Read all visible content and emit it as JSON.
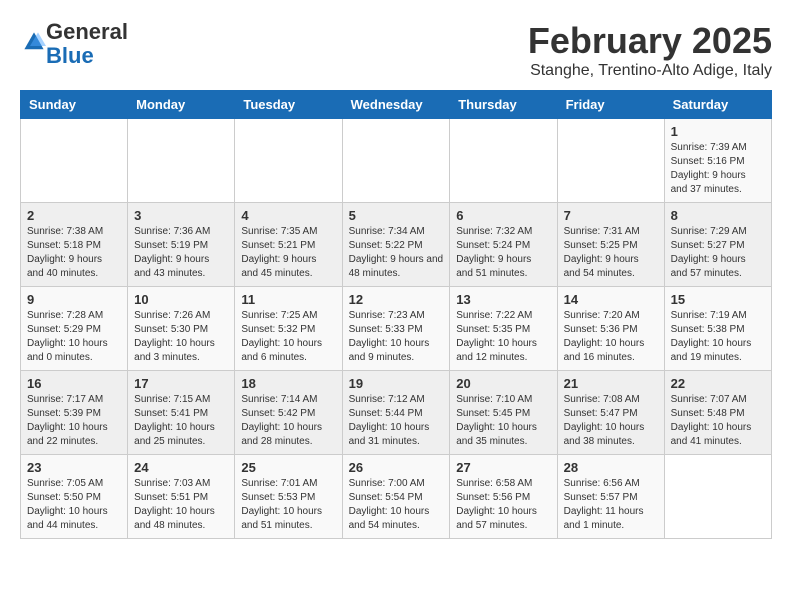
{
  "logo": {
    "general": "General",
    "blue": "Blue"
  },
  "header": {
    "month_title": "February 2025",
    "subtitle": "Stanghe, Trentino-Alto Adige, Italy"
  },
  "weekdays": [
    "Sunday",
    "Monday",
    "Tuesday",
    "Wednesday",
    "Thursday",
    "Friday",
    "Saturday"
  ],
  "weeks": [
    [
      {
        "day": "",
        "info": ""
      },
      {
        "day": "",
        "info": ""
      },
      {
        "day": "",
        "info": ""
      },
      {
        "day": "",
        "info": ""
      },
      {
        "day": "",
        "info": ""
      },
      {
        "day": "",
        "info": ""
      },
      {
        "day": "1",
        "info": "Sunrise: 7:39 AM\nSunset: 5:16 PM\nDaylight: 9 hours and 37 minutes."
      }
    ],
    [
      {
        "day": "2",
        "info": "Sunrise: 7:38 AM\nSunset: 5:18 PM\nDaylight: 9 hours and 40 minutes."
      },
      {
        "day": "3",
        "info": "Sunrise: 7:36 AM\nSunset: 5:19 PM\nDaylight: 9 hours and 43 minutes."
      },
      {
        "day": "4",
        "info": "Sunrise: 7:35 AM\nSunset: 5:21 PM\nDaylight: 9 hours and 45 minutes."
      },
      {
        "day": "5",
        "info": "Sunrise: 7:34 AM\nSunset: 5:22 PM\nDaylight: 9 hours and 48 minutes."
      },
      {
        "day": "6",
        "info": "Sunrise: 7:32 AM\nSunset: 5:24 PM\nDaylight: 9 hours and 51 minutes."
      },
      {
        "day": "7",
        "info": "Sunrise: 7:31 AM\nSunset: 5:25 PM\nDaylight: 9 hours and 54 minutes."
      },
      {
        "day": "8",
        "info": "Sunrise: 7:29 AM\nSunset: 5:27 PM\nDaylight: 9 hours and 57 minutes."
      }
    ],
    [
      {
        "day": "9",
        "info": "Sunrise: 7:28 AM\nSunset: 5:29 PM\nDaylight: 10 hours and 0 minutes."
      },
      {
        "day": "10",
        "info": "Sunrise: 7:26 AM\nSunset: 5:30 PM\nDaylight: 10 hours and 3 minutes."
      },
      {
        "day": "11",
        "info": "Sunrise: 7:25 AM\nSunset: 5:32 PM\nDaylight: 10 hours and 6 minutes."
      },
      {
        "day": "12",
        "info": "Sunrise: 7:23 AM\nSunset: 5:33 PM\nDaylight: 10 hours and 9 minutes."
      },
      {
        "day": "13",
        "info": "Sunrise: 7:22 AM\nSunset: 5:35 PM\nDaylight: 10 hours and 12 minutes."
      },
      {
        "day": "14",
        "info": "Sunrise: 7:20 AM\nSunset: 5:36 PM\nDaylight: 10 hours and 16 minutes."
      },
      {
        "day": "15",
        "info": "Sunrise: 7:19 AM\nSunset: 5:38 PM\nDaylight: 10 hours and 19 minutes."
      }
    ],
    [
      {
        "day": "16",
        "info": "Sunrise: 7:17 AM\nSunset: 5:39 PM\nDaylight: 10 hours and 22 minutes."
      },
      {
        "day": "17",
        "info": "Sunrise: 7:15 AM\nSunset: 5:41 PM\nDaylight: 10 hours and 25 minutes."
      },
      {
        "day": "18",
        "info": "Sunrise: 7:14 AM\nSunset: 5:42 PM\nDaylight: 10 hours and 28 minutes."
      },
      {
        "day": "19",
        "info": "Sunrise: 7:12 AM\nSunset: 5:44 PM\nDaylight: 10 hours and 31 minutes."
      },
      {
        "day": "20",
        "info": "Sunrise: 7:10 AM\nSunset: 5:45 PM\nDaylight: 10 hours and 35 minutes."
      },
      {
        "day": "21",
        "info": "Sunrise: 7:08 AM\nSunset: 5:47 PM\nDaylight: 10 hours and 38 minutes."
      },
      {
        "day": "22",
        "info": "Sunrise: 7:07 AM\nSunset: 5:48 PM\nDaylight: 10 hours and 41 minutes."
      }
    ],
    [
      {
        "day": "23",
        "info": "Sunrise: 7:05 AM\nSunset: 5:50 PM\nDaylight: 10 hours and 44 minutes."
      },
      {
        "day": "24",
        "info": "Sunrise: 7:03 AM\nSunset: 5:51 PM\nDaylight: 10 hours and 48 minutes."
      },
      {
        "day": "25",
        "info": "Sunrise: 7:01 AM\nSunset: 5:53 PM\nDaylight: 10 hours and 51 minutes."
      },
      {
        "day": "26",
        "info": "Sunrise: 7:00 AM\nSunset: 5:54 PM\nDaylight: 10 hours and 54 minutes."
      },
      {
        "day": "27",
        "info": "Sunrise: 6:58 AM\nSunset: 5:56 PM\nDaylight: 10 hours and 57 minutes."
      },
      {
        "day": "28",
        "info": "Sunrise: 6:56 AM\nSunset: 5:57 PM\nDaylight: 11 hours and 1 minute."
      },
      {
        "day": "",
        "info": ""
      }
    ]
  ]
}
